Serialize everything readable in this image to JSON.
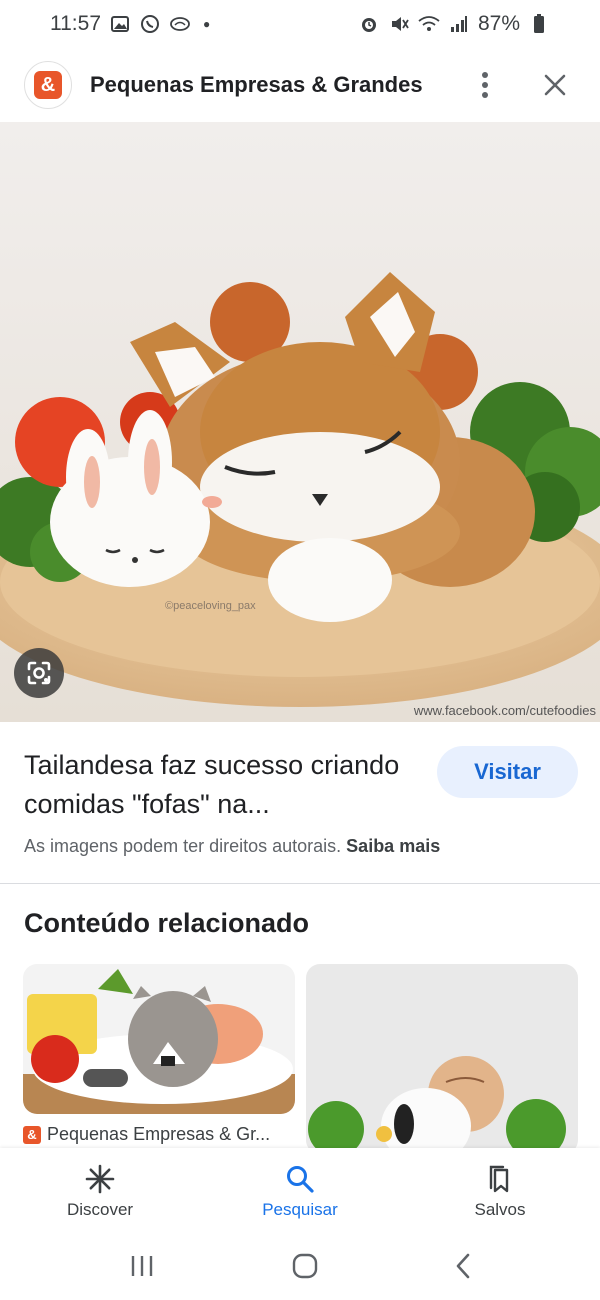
{
  "status_bar": {
    "time": "11:57",
    "battery": "87%"
  },
  "header": {
    "favicon_glyph": "&",
    "title": "Pequenas Empresas & Grandes",
    "title_ellipsis": "..."
  },
  "hero": {
    "image_credit": "©peaceloving_pax",
    "watermark": "www.facebook.com/cutefoodies"
  },
  "result": {
    "title": "Tailandesa faz sucesso criando comidas \"fofas\" na...",
    "visit_label": "Visitar",
    "copyright_text": "As imagens podem ter direitos autorais.",
    "learn_more": "Saiba mais"
  },
  "related": {
    "heading": "Conteúdo relacionado",
    "items": [
      {
        "source": "Pequenas Empresas & Gr..."
      }
    ]
  },
  "bottom_nav": {
    "items": [
      {
        "label": "Discover",
        "icon": "asterisk-icon"
      },
      {
        "label": "Pesquisar",
        "icon": "search-icon",
        "active": true
      },
      {
        "label": "Salvos",
        "icon": "bookmarks-icon"
      }
    ]
  },
  "colors": {
    "accent": "#1a73e8",
    "brand": "#e8562a",
    "visit_bg": "#e8f0fe"
  }
}
